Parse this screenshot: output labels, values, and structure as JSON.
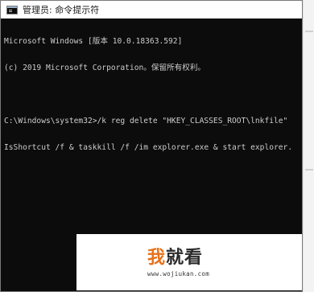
{
  "window": {
    "title": "管理员: 命令提示符",
    "title_icon": "command-prompt-icon"
  },
  "console": {
    "lines": [
      "Microsoft Windows [版本 10.0.18363.592]",
      "(c) 2019 Microsoft Corporation。保留所有权利。",
      "",
      "C:\\Windows\\system32>/k reg delete \"HKEY_CLASSES_ROOT\\lnkfile\" /v",
      "IsShortcut /f & taskkill /f /im explorer.exe & start explorer.exe"
    ],
    "text_color": "#cccccc",
    "background": "#0c0c0c"
  },
  "watermark": {
    "logo_part1": "我",
    "logo_part2": "就看",
    "url": "www.wojiukan.com",
    "accent": "#e8711a"
  }
}
